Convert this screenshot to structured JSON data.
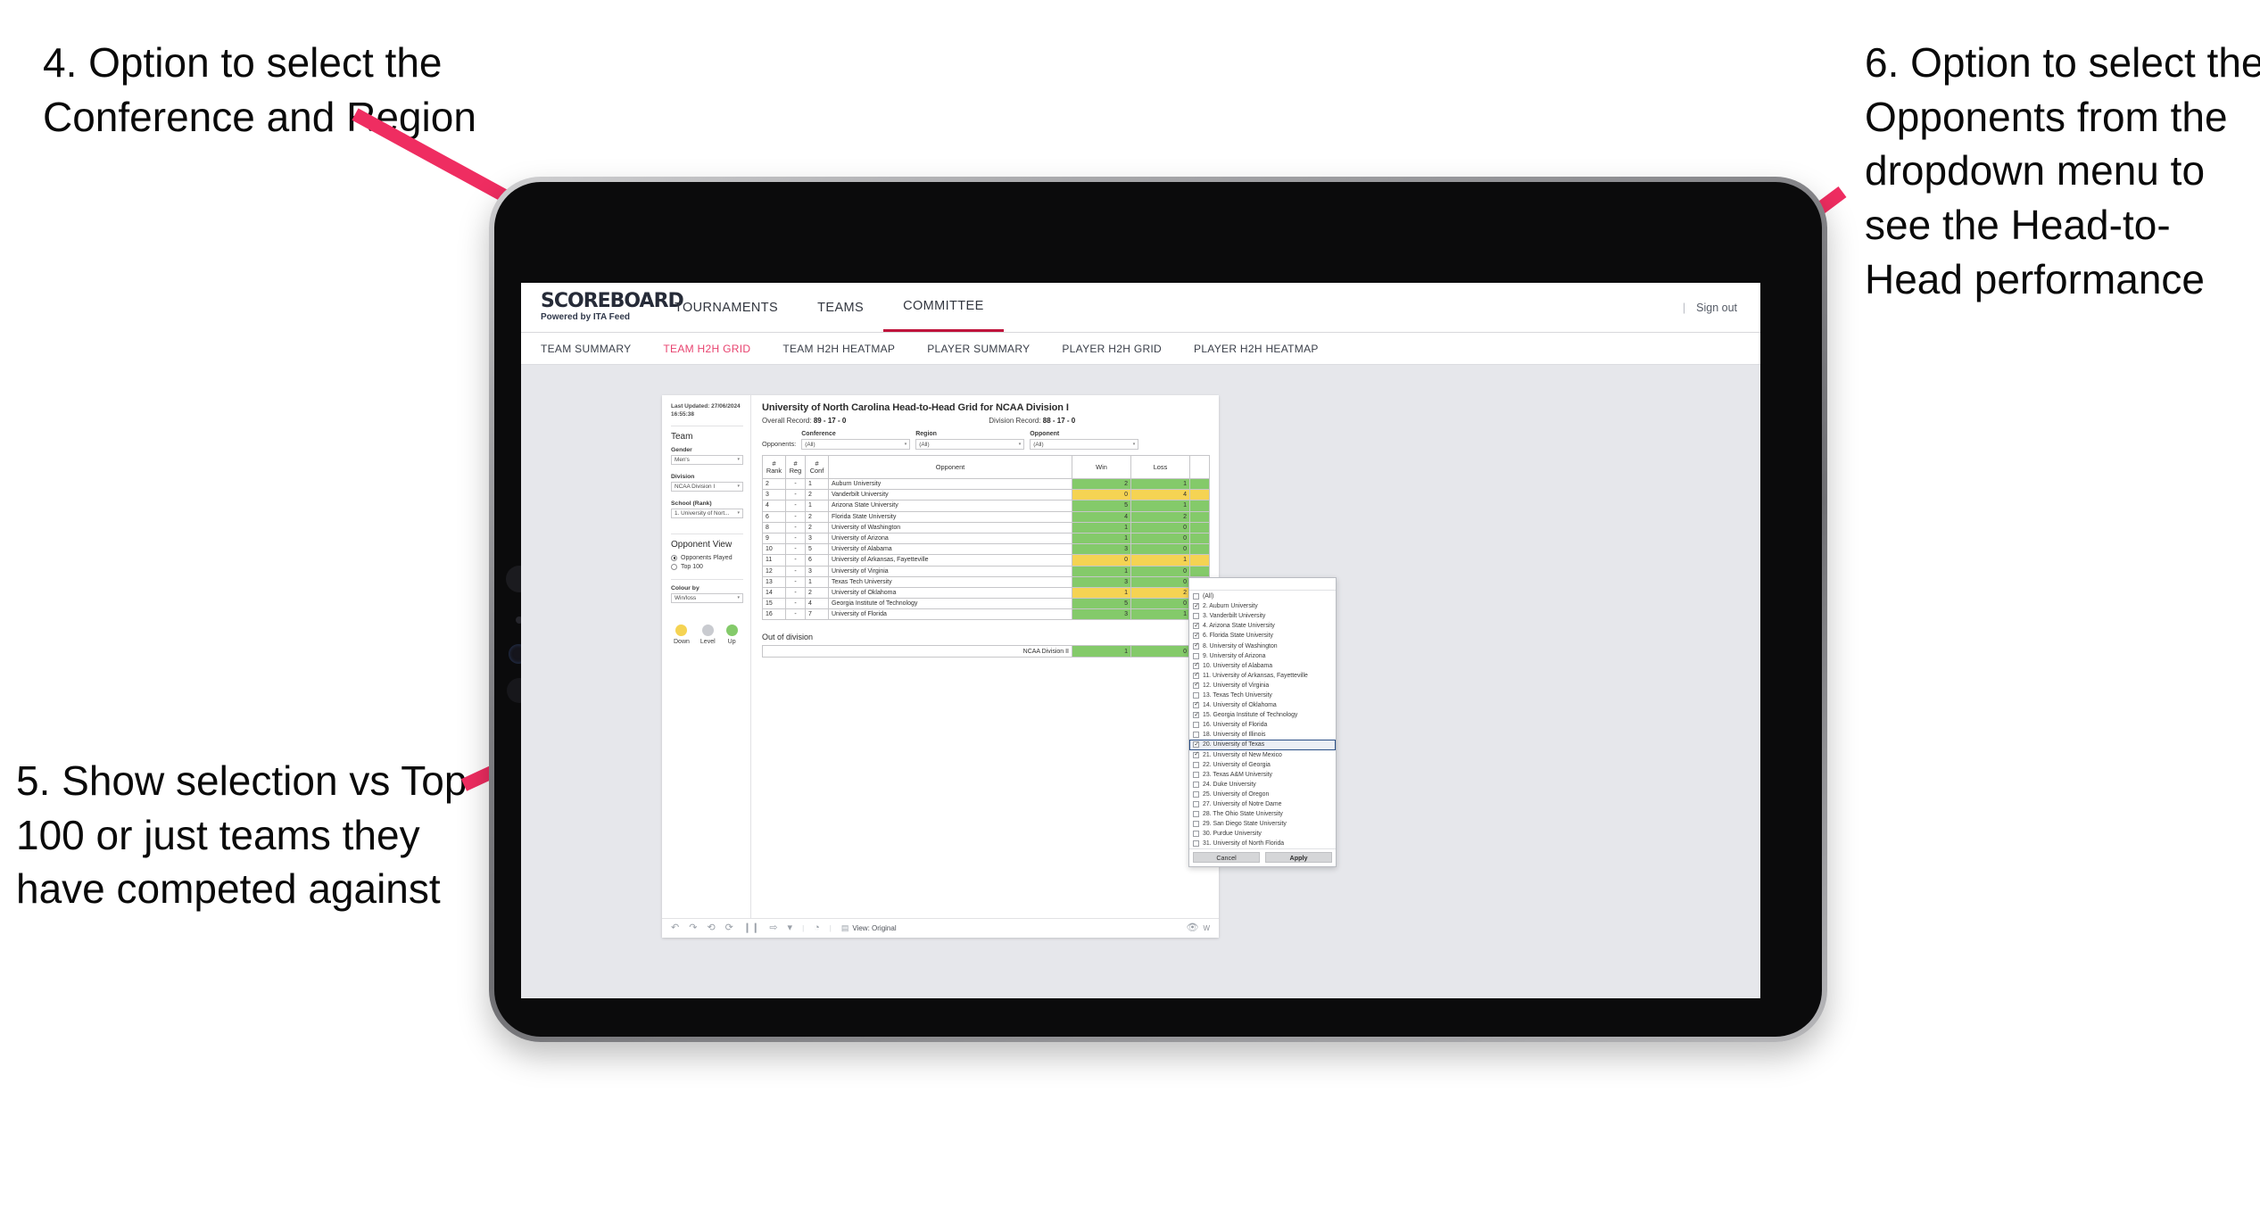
{
  "annotations": {
    "left_top": "4. Option to select the Conference and Region",
    "left_bottom": "5. Show selection vs Top 100 or just teams they have competed against",
    "right_top": "6. Option to select the Opponents from the dropdown menu to see the Head-to-Head performance"
  },
  "colors": {
    "accent_pink": "#ef2d61",
    "brand_red": "#c0143c",
    "tab_active": "#e8436f",
    "up_green": "#84ca6a",
    "down_yellow": "#f5d353",
    "level_grey": "#c9cbd0",
    "selection_blue": "#2b4f86"
  },
  "header": {
    "brand_name": "SCOREBOARD",
    "brand_sub": "Powered by ITA Feed",
    "nav": [
      {
        "label": "TOURNAMENTS",
        "active": false
      },
      {
        "label": "TEAMS",
        "active": false
      },
      {
        "label": "COMMITTEE",
        "active": true
      }
    ],
    "divider": "|",
    "sign_out": "Sign out"
  },
  "subnav": [
    {
      "label": "TEAM SUMMARY",
      "active": false
    },
    {
      "label": "TEAM H2H GRID",
      "active": true
    },
    {
      "label": "TEAM H2H HEATMAP",
      "active": false
    },
    {
      "label": "PLAYER SUMMARY",
      "active": false
    },
    {
      "label": "PLAYER H2H GRID",
      "active": false
    },
    {
      "label": "PLAYER H2H HEATMAP",
      "active": false
    }
  ],
  "sidebar": {
    "last_updated_line1": "Last Updated: 27/06/2024",
    "last_updated_line2": "16:55:38",
    "team_heading": "Team",
    "gender_label": "Gender",
    "gender_value": "Men's",
    "division_label": "Division",
    "division_value": "NCAA Division I",
    "school_label": "School (Rank)",
    "school_value": "1. University of Nort...",
    "opponent_view_heading": "Opponent View",
    "opponent_view_options": [
      {
        "label": "Opponents Played",
        "selected": true
      },
      {
        "label": "Top 100",
        "selected": false
      }
    ],
    "colour_by_label": "Colour by",
    "colour_by_value": "Win/loss",
    "legend": [
      {
        "label": "Down",
        "color": "#f5d353"
      },
      {
        "label": "Level",
        "color": "#c9cbd0"
      },
      {
        "label": "Up",
        "color": "#84ca6a"
      }
    ]
  },
  "view": {
    "title": "University of North Carolina Head-to-Head Grid for NCAA Division I",
    "overall_record_label": "Overall Record:",
    "overall_record_value": "89 - 17 - 0",
    "division_record_label": "Division Record:",
    "division_record_value": "88 - 17 - 0",
    "opponents_label": "Opponents:",
    "filters": [
      {
        "label": "Conference",
        "value": "(All)"
      },
      {
        "label": "Region",
        "value": "(All)"
      },
      {
        "label": "Opponent",
        "value": "(All)"
      }
    ],
    "out_of_division_title": "Out of division",
    "out_of_division_row": {
      "label": "NCAA Division II",
      "win": "1",
      "loss": "0",
      "state": "up"
    }
  },
  "chart_data": {
    "type": "table",
    "title": "University of North Carolina Head-to-Head Grid for NCAA Division I",
    "columns": [
      "# Rank",
      "# Reg",
      "# Conf",
      "Opponent",
      "Win",
      "Loss"
    ],
    "rows": [
      {
        "rank": "2",
        "reg": "-",
        "conf": "1",
        "opponent": "Auburn University",
        "win": "2",
        "loss": "1",
        "state": "up"
      },
      {
        "rank": "3",
        "reg": "-",
        "conf": "2",
        "opponent": "Vanderbilt University",
        "win": "0",
        "loss": "4",
        "state": "down"
      },
      {
        "rank": "4",
        "reg": "-",
        "conf": "1",
        "opponent": "Arizona State University",
        "win": "5",
        "loss": "1",
        "state": "up"
      },
      {
        "rank": "6",
        "reg": "-",
        "conf": "2",
        "opponent": "Florida State University",
        "win": "4",
        "loss": "2",
        "state": "up"
      },
      {
        "rank": "8",
        "reg": "-",
        "conf": "2",
        "opponent": "University of Washington",
        "win": "1",
        "loss": "0",
        "state": "up"
      },
      {
        "rank": "9",
        "reg": "-",
        "conf": "3",
        "opponent": "University of Arizona",
        "win": "1",
        "loss": "0",
        "state": "up"
      },
      {
        "rank": "10",
        "reg": "-",
        "conf": "5",
        "opponent": "University of Alabama",
        "win": "3",
        "loss": "0",
        "state": "up"
      },
      {
        "rank": "11",
        "reg": "-",
        "conf": "6",
        "opponent": "University of Arkansas, Fayetteville",
        "win": "0",
        "loss": "1",
        "state": "down"
      },
      {
        "rank": "12",
        "reg": "-",
        "conf": "3",
        "opponent": "University of Virginia",
        "win": "1",
        "loss": "0",
        "state": "up"
      },
      {
        "rank": "13",
        "reg": "-",
        "conf": "1",
        "opponent": "Texas Tech University",
        "win": "3",
        "loss": "0",
        "state": "up"
      },
      {
        "rank": "14",
        "reg": "-",
        "conf": "2",
        "opponent": "University of Oklahoma",
        "win": "1",
        "loss": "2",
        "state": "down"
      },
      {
        "rank": "15",
        "reg": "-",
        "conf": "4",
        "opponent": "Georgia Institute of Technology",
        "win": "5",
        "loss": "0",
        "state": "up"
      },
      {
        "rank": "16",
        "reg": "-",
        "conf": "7",
        "opponent": "University of Florida",
        "win": "3",
        "loss": "1",
        "state": "up"
      }
    ]
  },
  "opponent_dropdown": {
    "options": [
      {
        "label": "(All)",
        "checked": false,
        "selected": false
      },
      {
        "label": "2. Auburn University",
        "checked": true,
        "selected": false
      },
      {
        "label": "3. Vanderbilt University",
        "checked": false,
        "selected": false
      },
      {
        "label": "4. Arizona State University",
        "checked": true,
        "selected": false
      },
      {
        "label": "6. Florida State University",
        "checked": true,
        "selected": false
      },
      {
        "label": "8. University of Washington",
        "checked": true,
        "selected": false
      },
      {
        "label": "9. University of Arizona",
        "checked": false,
        "selected": false
      },
      {
        "label": "10. University of Alabama",
        "checked": true,
        "selected": false
      },
      {
        "label": "11. University of Arkansas, Fayetteville",
        "checked": true,
        "selected": false
      },
      {
        "label": "12. University of Virginia",
        "checked": true,
        "selected": false
      },
      {
        "label": "13. Texas Tech University",
        "checked": false,
        "selected": false
      },
      {
        "label": "14. University of Oklahoma",
        "checked": true,
        "selected": false
      },
      {
        "label": "15. Georgia Institute of Technology",
        "checked": true,
        "selected": false
      },
      {
        "label": "16. University of Florida",
        "checked": false,
        "selected": false
      },
      {
        "label": "18. University of Illinois",
        "checked": false,
        "selected": false
      },
      {
        "label": "20. University of Texas",
        "checked": true,
        "selected": true
      },
      {
        "label": "21. University of New Mexico",
        "checked": true,
        "selected": false
      },
      {
        "label": "22. University of Georgia",
        "checked": false,
        "selected": false
      },
      {
        "label": "23. Texas A&M University",
        "checked": false,
        "selected": false
      },
      {
        "label": "24. Duke University",
        "checked": false,
        "selected": false
      },
      {
        "label": "25. University of Oregon",
        "checked": false,
        "selected": false
      },
      {
        "label": "27. University of Notre Dame",
        "checked": false,
        "selected": false
      },
      {
        "label": "28. The Ohio State University",
        "checked": false,
        "selected": false
      },
      {
        "label": "29. San Diego State University",
        "checked": false,
        "selected": false
      },
      {
        "label": "30. Purdue University",
        "checked": false,
        "selected": false
      },
      {
        "label": "31. University of North Florida",
        "checked": false,
        "selected": false
      }
    ],
    "cancel_label": "Cancel",
    "apply_label": "Apply"
  },
  "toolbar": {
    "view_label": "View: Original",
    "watch_label": "W"
  }
}
